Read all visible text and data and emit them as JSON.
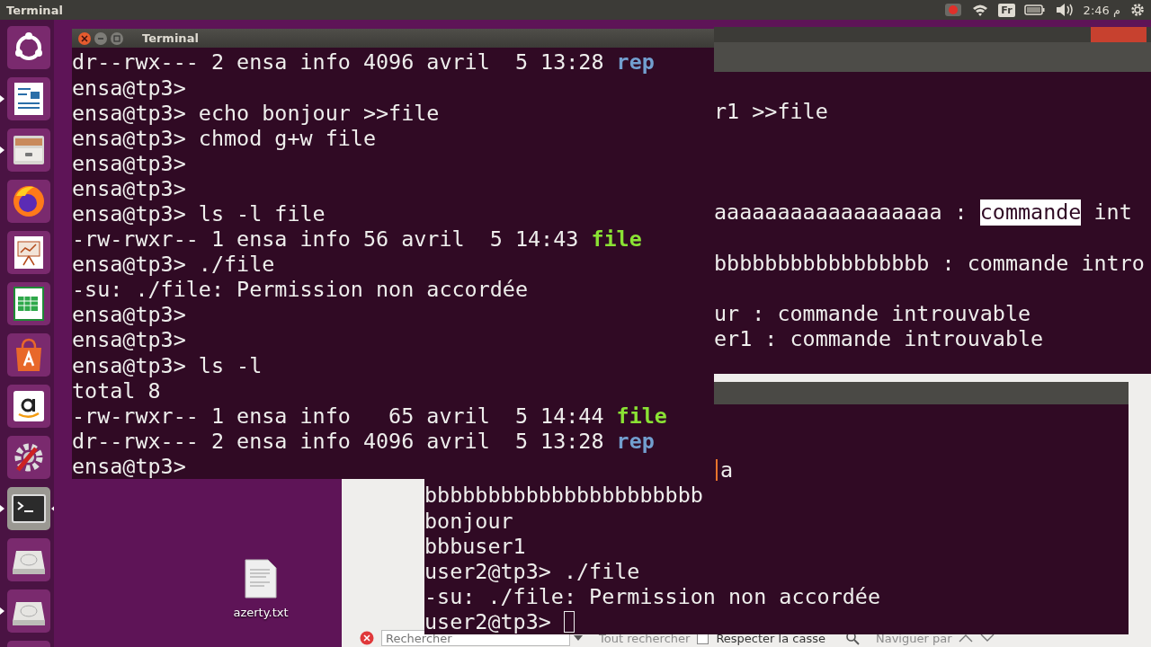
{
  "top_bar": {
    "title": "Terminal",
    "keyboard_layout": "Fr",
    "clock": "م 2:46"
  },
  "launcher": [
    {
      "kind": "ubuntu",
      "running": false,
      "focused": false
    },
    {
      "kind": "writer",
      "running": true,
      "focused": false
    },
    {
      "kind": "files",
      "running": true,
      "focused": false
    },
    {
      "kind": "firefox",
      "running": false,
      "focused": false
    },
    {
      "kind": "impress",
      "running": false,
      "focused": false
    },
    {
      "kind": "calc",
      "running": false,
      "focused": false
    },
    {
      "kind": "software",
      "running": false,
      "focused": false
    },
    {
      "kind": "amazon",
      "running": false,
      "focused": false
    },
    {
      "kind": "settings",
      "running": false,
      "focused": false
    },
    {
      "kind": "terminal",
      "running": true,
      "focused": true
    },
    {
      "kind": "disk",
      "running": false,
      "focused": false
    },
    {
      "kind": "disk",
      "running": true,
      "focused": false
    },
    {
      "kind": "trash"
    }
  ],
  "desktop_icons": [
    {
      "label": "azerty.txt"
    }
  ],
  "back_terminal": {
    "lines": [
      {
        "kind": "blank"
      },
      {
        "kind": "text",
        "segments": [
          {
            "text": "r1 >>file",
            "kind": "plain"
          }
        ]
      },
      {
        "kind": "blank"
      },
      {
        "kind": "blank"
      },
      {
        "kind": "blank"
      },
      {
        "kind": "text",
        "segments": [
          {
            "text": "aaaaaaaaaaaaaaaaaa : ",
            "kind": "plain"
          },
          {
            "text": "commande",
            "kind": "selection"
          },
          {
            "text": " int",
            "kind": "plain"
          }
        ]
      },
      {
        "kind": "blank"
      },
      {
        "kind": "text",
        "segments": [
          {
            "text": "bbbbbbbbbbbbbbbbb : commande intro",
            "kind": "plain"
          }
        ]
      },
      {
        "kind": "blank"
      },
      {
        "kind": "text",
        "segments": [
          {
            "text": "ur : commande introuvable",
            "kind": "plain"
          }
        ]
      },
      {
        "kind": "text",
        "segments": [
          {
            "text": "er1 : commande introuvable",
            "kind": "plain"
          }
        ]
      }
    ]
  },
  "document_window": {
    "find_bar": {
      "placeholder": "Rechercher",
      "find_all": "Tout rechercher",
      "match_case": {
        "label": "Respecter la casse",
        "checked": false
      },
      "navigate": "Naviguer par"
    }
  },
  "second_terminal": {
    "lines": [
      {
        "kind": "text",
        "segments": [
          {
            "text": "a",
            "kind": "tail"
          }
        ]
      },
      {
        "kind": "text",
        "segments": [
          {
            "text": "bbbbbbbbbbbbbbbbbbbbbb",
            "kind": "plain"
          }
        ]
      },
      {
        "kind": "text",
        "segments": [
          {
            "text": "bonjour",
            "kind": "plain"
          }
        ]
      },
      {
        "kind": "text",
        "segments": [
          {
            "text": "bbbuser1",
            "kind": "plain"
          }
        ]
      },
      {
        "kind": "text",
        "segments": [
          {
            "text": "user2@tp3> ./file",
            "kind": "plain"
          }
        ]
      },
      {
        "kind": "text",
        "segments": [
          {
            "text": "-su: ./file: Permission non accordée",
            "kind": "plain"
          }
        ]
      },
      {
        "kind": "text",
        "cursor": true,
        "segments": [
          {
            "text": "user2@tp3> ",
            "kind": "plain"
          }
        ]
      }
    ]
  },
  "terminal": {
    "title": "Terminal",
    "lines": [
      {
        "kind": "text",
        "segments": [
          {
            "text": "dr--rwx--- 2 ensa info 4096 avril  5 13:28 ",
            "kind": "plain"
          },
          {
            "text": "rep",
            "kind": "dir"
          }
        ]
      },
      {
        "kind": "text",
        "segments": [
          {
            "text": "ensa@tp3>",
            "kind": "plain"
          }
        ]
      },
      {
        "kind": "text",
        "segments": [
          {
            "text": "ensa@tp3> echo bonjour >>file",
            "kind": "plain"
          }
        ]
      },
      {
        "kind": "text",
        "segments": [
          {
            "text": "ensa@tp3> chmod g+w file",
            "kind": "plain"
          }
        ]
      },
      {
        "kind": "text",
        "segments": [
          {
            "text": "ensa@tp3>",
            "kind": "plain"
          }
        ]
      },
      {
        "kind": "text",
        "segments": [
          {
            "text": "ensa@tp3>",
            "kind": "plain"
          }
        ]
      },
      {
        "kind": "text",
        "segments": [
          {
            "text": "ensa@tp3> ls -l file",
            "kind": "plain"
          }
        ]
      },
      {
        "kind": "text",
        "segments": [
          {
            "text": "-rw-rwxr-- 1 ensa info 56 avril  5 14:43 ",
            "kind": "plain"
          },
          {
            "text": "file",
            "kind": "exec"
          }
        ]
      },
      {
        "kind": "text",
        "segments": [
          {
            "text": "ensa@tp3> ./file",
            "kind": "plain"
          }
        ]
      },
      {
        "kind": "text",
        "segments": [
          {
            "text": "-su: ./file: Permission non accordée",
            "kind": "plain"
          }
        ]
      },
      {
        "kind": "text",
        "segments": [
          {
            "text": "ensa@tp3>",
            "kind": "plain"
          }
        ]
      },
      {
        "kind": "text",
        "segments": [
          {
            "text": "ensa@tp3>",
            "kind": "plain"
          }
        ]
      },
      {
        "kind": "text",
        "segments": [
          {
            "text": "ensa@tp3> ls -l",
            "kind": "plain"
          }
        ]
      },
      {
        "kind": "text",
        "segments": [
          {
            "text": "total 8",
            "kind": "plain"
          }
        ]
      },
      {
        "kind": "text",
        "segments": [
          {
            "text": "-rw-rwxr-- 1 ensa info   65 avril  5 14:44 ",
            "kind": "plain"
          },
          {
            "text": "file",
            "kind": "exec"
          }
        ]
      },
      {
        "kind": "text",
        "segments": [
          {
            "text": "dr--rwx--- 2 ensa info 4096 avril  5 13:28 ",
            "kind": "plain"
          },
          {
            "text": "rep",
            "kind": "dir"
          }
        ]
      },
      {
        "kind": "text",
        "segments": [
          {
            "text": "ensa@tp3>",
            "kind": "plain"
          }
        ]
      }
    ]
  }
}
